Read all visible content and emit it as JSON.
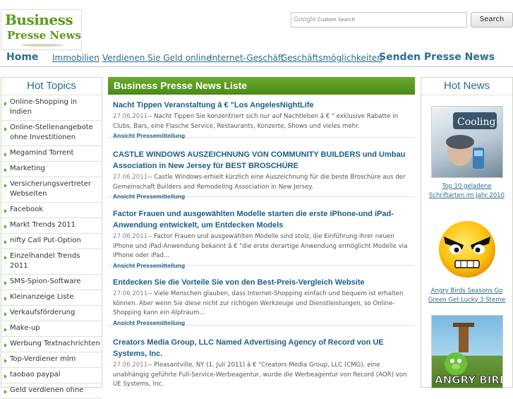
{
  "logo": {
    "line1": "Business",
    "line2": "Presse News"
  },
  "search": {
    "google_label": "Google",
    "placeholder": "Custom Search",
    "button": "Search"
  },
  "nav": {
    "home": "Home",
    "items": [
      "Immobilien",
      "Verdienen Sie Geld online",
      "Internet-Geschäft",
      "Geschäftsmöglichkeiten"
    ],
    "send": "Senden Presse News"
  },
  "hot_topics": {
    "title": "Hot Topics",
    "items": [
      "Online-Shopping in Indien",
      "Online-Stellenangebote ohne Investitionen",
      "Megamind Torrent",
      "Marketing",
      "Versicherungsvertreter Webseiten",
      "Facebook",
      "Markt Trends 2011",
      "nifty Call Put-Option",
      "Einzelhandel Trends 2011",
      "SMS-Spion-Software",
      "Kleinanzeige Liste",
      "Verkaufsförderung",
      "Make-up",
      "Werbung Textnachrichten",
      "Top-Verdiener mlm",
      "taobao paypal",
      "Geld verdienen ohne"
    ]
  },
  "main": {
    "title": "Business Presse News Liste",
    "more_label": "Ansicht Pressemitteilung",
    "articles": [
      {
        "title": "Nacht Tippen Veranstaltung â € \"Los AngelesNightLife",
        "date": "27.06.2011",
        "text": "-- Nacht Tippen Sie konzentriert sich nur auf Nachtleben â € \" exklusive Rabatte in Clubs, Bars, eine Flasche Service, Restaurants, Konzerte, Shows und vieles mehr."
      },
      {
        "title": "CASTLE WINDOWS AUSZEICHNUNG VON COMMUNITY BUILDERS und Umbau Association in New Jersey für BEST BROSCHÜRE",
        "date": "27.06.2011",
        "text": "-- Castle Windows-erhielt kürzlich eine Auszeichnung für die beste Broschüre aus der Gemeinschaft Builders and Remodeling Association in New Jersey."
      },
      {
        "title": "Factor Frauen und ausgewählten Modelle starten die erste iPhone-und iPad-Anwendung entwickelt, um Entdecken Models",
        "date": "27.06.2011",
        "text": "-- Factor Frauen und ausgewählten Modelle sind stolz, die Einführung ihrer neuen iPhone und iPad-Anwendung bekannt â € \"die erste derartige Anwendung ermöglicht Modelle via iPhone oder iPad..."
      },
      {
        "title": "Entdecken Sie die Vorteile Sie von den Best-Preis-Vergleich Website",
        "date": "27.06.2011",
        "text": "-- Viele Menschen glauben, dass Internet-Shopping einfach und bequem ist erhalten können. Aber wenn Sie diese nicht zur richtigen Werkzeuge und Dienstleistungen, so Online-Shopping kann ein Alptraum..."
      },
      {
        "title": "Creators Media Group, LLC Named Advertising Agency of Record von UE Systems, Inc.",
        "date": "27.06.2011",
        "text": "-- Pleasantville, NY (1. Juli 2011) â € \"Creators Media Group, LLC (CMG), eine unabhängig geführte Full-Service-Werbeagentur, wurde die Werbeagentur von Record (AOR) von UE Systems, Inc."
      }
    ]
  },
  "hot_news": {
    "title": "Hot News",
    "items": [
      {
        "caption": "Top 10 geladene Schriftarten im Jahr 2010",
        "image_text": "Cooling"
      },
      {
        "caption": "Angry Birds Seasons Go Green Get Lucky 3 Sterne",
        "image_text": ""
      },
      {
        "caption": "",
        "image_text": "ANGRY BIRDS"
      }
    ]
  },
  "colors": {
    "accent_green": "#5a9a18",
    "link_blue": "#1a5f86",
    "nav_blue": "#2b6e8f"
  }
}
